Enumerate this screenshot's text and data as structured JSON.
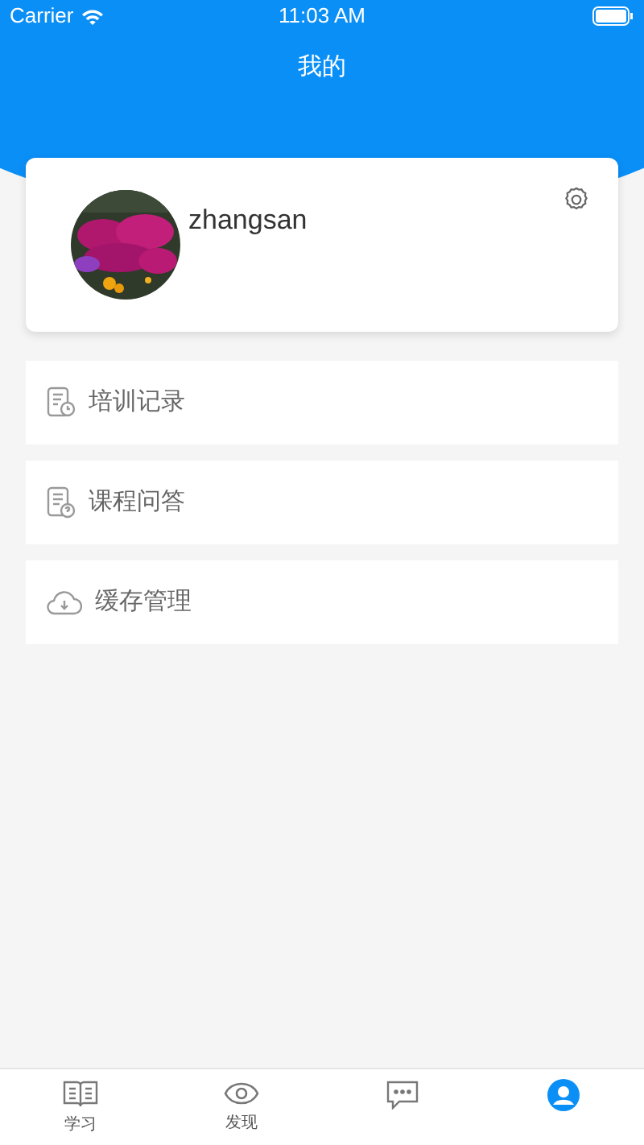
{
  "status_bar": {
    "carrier": "Carrier",
    "time": "11:03 AM"
  },
  "title": "我的",
  "profile": {
    "username": "zhangsan"
  },
  "menu": [
    {
      "label": "培训记录",
      "kind": "record"
    },
    {
      "label": "课程问答",
      "kind": "qa"
    },
    {
      "label": "缓存管理",
      "kind": "download"
    }
  ],
  "tab_bar": [
    {
      "label": "学习",
      "kind": "book",
      "selected": false
    },
    {
      "label": "发现",
      "kind": "eye",
      "selected": false
    },
    {
      "kind": "chat",
      "selected": false
    },
    {
      "kind": "person",
      "selected": true
    }
  ]
}
